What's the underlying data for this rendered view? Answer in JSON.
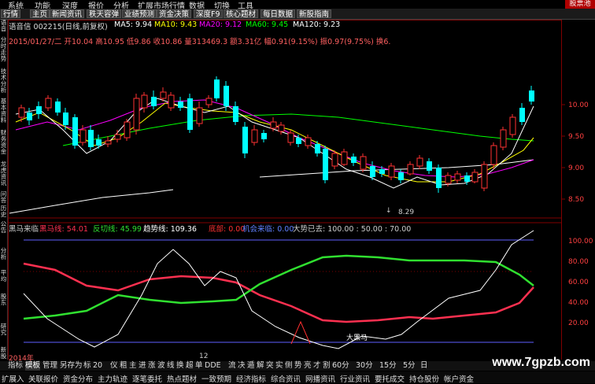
{
  "menu": [
    "系统",
    "功能",
    "深度",
    "报价",
    "分析",
    "扩展市场行情",
    "数据",
    "切换",
    "工具"
  ],
  "brand": "股票池",
  "tabs": [
    "行情",
    "主页",
    "新闻资讯",
    "秩天容弹",
    "业绩预测",
    "资金决策",
    "深度F9",
    "核心题材",
    "每日数据",
    "新股指南"
  ],
  "header": {
    "stock_title": "语音信 002215(日线,前复权)",
    "ma5": "MA5: 9.94",
    "ma10": "MA10: 9.43",
    "ma20": "MA20: 9.12",
    "ma60": "MA60: 9.45",
    "ma120": "MA120: 9.23",
    "ohlc": "2015/01/27/二  开10.04  高10.95  低9.86  收10.86  量313469.3  额3.31亿  幅0.91(9.15%)  振0.97(9.75%)  换6.",
    "low_marker": "8.29"
  },
  "price_axis": [
    "10.00",
    "9.50",
    "9.00",
    "8.50"
  ],
  "indicator": {
    "name": "黑马来临",
    "heima": "黑马线: 54.01",
    "fanqie": "反切线: 45.99",
    "qushi": "趋势线: 109.36",
    "dibu": "底部: 0.00",
    "jihui": "机会来临: 0.00",
    "dashi": "大势已去: 100.00 : 50.00 : 70.00",
    "label": "大黑马",
    "axis": [
      "100.00",
      "80.00",
      "60.00",
      "40.00",
      "20.00"
    ]
  },
  "dates": [
    "2014年",
    "12"
  ],
  "sidebar": [
    "语音",
    "分时走势",
    "技术分析",
    "基本资料",
    "财务资金",
    "龙虎资讯",
    "问答",
    "历史",
    "公告",
    "分析",
    "平均",
    "股东",
    "研究",
    "新股"
  ],
  "bottom_tabs": [
    "指标",
    "模板",
    "管理",
    "另存为",
    "标",
    "20",
    "仪",
    "粗",
    "主",
    "进",
    "涨",
    "波",
    "线",
    "换",
    "超",
    "单",
    "DDE",
    "流",
    "决",
    "遁",
    "解",
    "突",
    "实",
    "侧",
    "势",
    "亮",
    "才",
    "割",
    "60分",
    "30分",
    "15分",
    "5分",
    "日"
  ],
  "footer_tabs": [
    "扩展入",
    "关联报价",
    "资金分布",
    "主力轨迹",
    "逐笔委托",
    "热点题材",
    "一致预期",
    "经济指标",
    "综合资讯",
    "网播资讯",
    "行业资讯",
    "要托成交",
    "持仓股份",
    "帐户资金"
  ],
  "watermark": "www.7gpzb.com",
  "colors": {
    "up": "#ff3232",
    "down": "#00ffff",
    "ma5": "#ffffff",
    "ma10": "#ffff00",
    "ma20": "#ff00ff",
    "ma60": "#00ff00",
    "ma120": "#ffffff"
  }
}
